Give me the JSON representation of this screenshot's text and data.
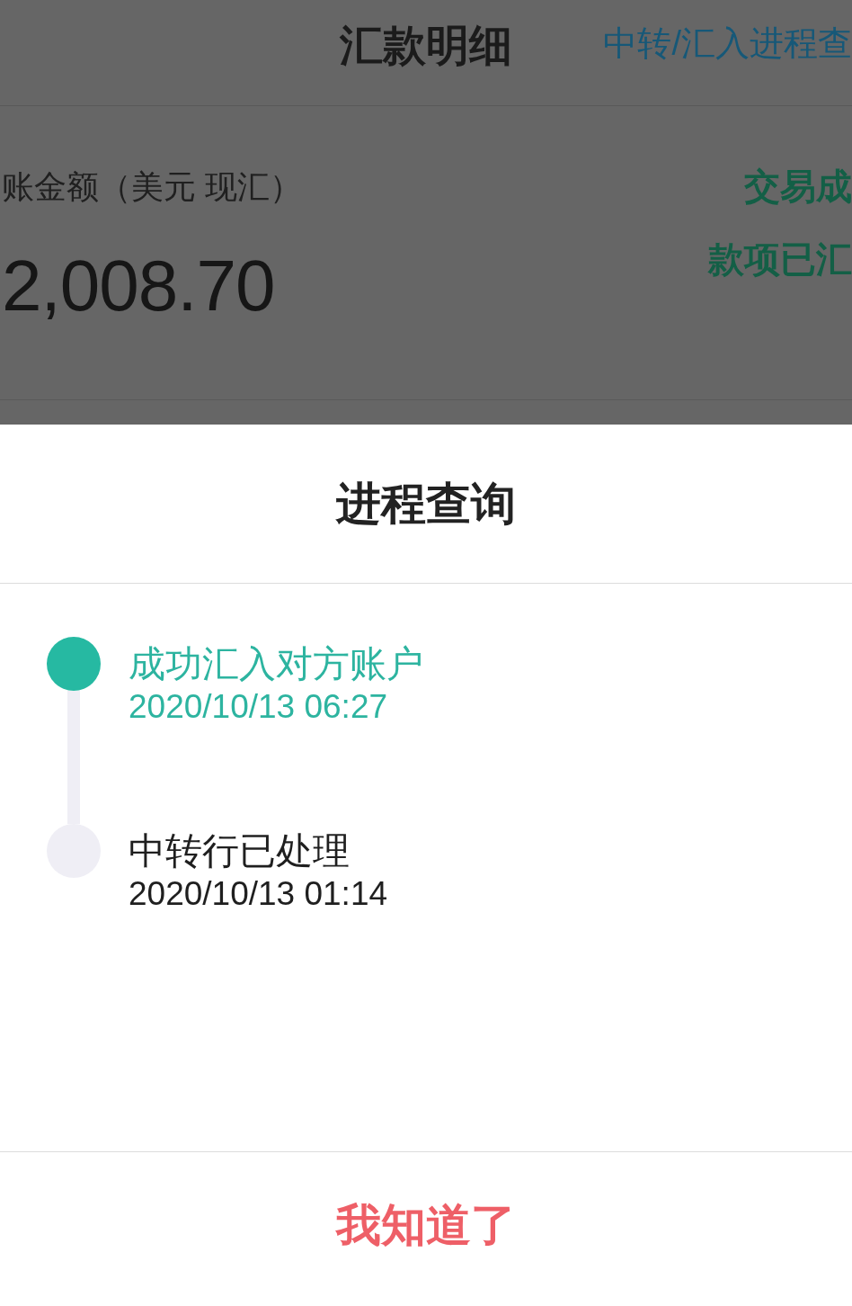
{
  "background_page": {
    "title": "汇款明细",
    "link": "中转/汇入进程查",
    "amount_label": "账金额（美元 现汇）",
    "amount": "2,008.70",
    "status": "交易成",
    "status_detail": "款项已汇"
  },
  "sheet": {
    "title": "进程查询",
    "steps": [
      {
        "label": "成功汇入对方账户",
        "time": "2020/10/13 06:27",
        "current": true
      },
      {
        "label": "中转行已处理",
        "time": "2020/10/13 01:14",
        "current": false
      }
    ],
    "button": "我知道了"
  }
}
